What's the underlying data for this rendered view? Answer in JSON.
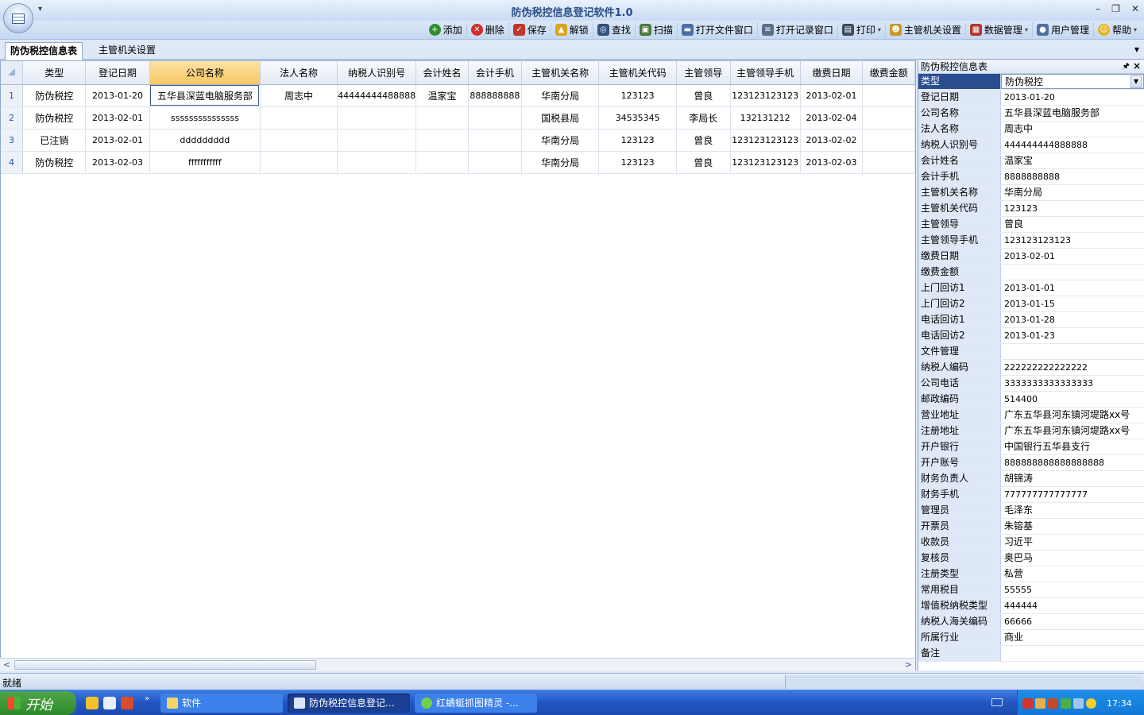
{
  "window": {
    "title": "防伪税控信息登记软件1.0"
  },
  "toolbar": {
    "buttons": [
      {
        "label": "添加",
        "icon": "add-icon",
        "color": "#2f8f2f"
      },
      {
        "label": "删除",
        "icon": "delete-icon",
        "color": "#d52b2b"
      },
      {
        "label": "保存",
        "icon": "save-icon",
        "color": "#c0362c"
      },
      {
        "label": "解锁",
        "icon": "lock-icon",
        "color": "#d9a520"
      },
      {
        "label": "查找",
        "icon": "search-icon",
        "color": "#34507c"
      },
      {
        "label": "扫描",
        "icon": "scan-icon",
        "color": "#4a7a3c"
      },
      {
        "label": "打开文件窗口",
        "icon": "folder-icon",
        "color": "#4b6ea8"
      },
      {
        "label": "打开记录窗口",
        "icon": "list-icon",
        "color": "#5c6f8a"
      },
      {
        "label": "打印",
        "icon": "print-icon",
        "color": "#3d4a5c",
        "dropdown": true
      },
      {
        "label": "主管机关设置",
        "icon": "person-settings-icon",
        "color": "#c9962a"
      },
      {
        "label": "数据管理",
        "icon": "table-icon",
        "color": "#b2352d",
        "dropdown": true
      },
      {
        "label": "用户管理",
        "icon": "user-icon",
        "color": "#4d6fa3"
      },
      {
        "label": "帮助",
        "icon": "help-smiley-icon",
        "color": "#e6b421",
        "dropdown": true
      }
    ]
  },
  "tabs": {
    "active": "防伪税控信息表",
    "inactive": "主管机关设置"
  },
  "grid": {
    "columns": [
      "类型",
      "登记日期",
      "公司名称",
      "法人名称",
      "纳税人识别号",
      "会计姓名",
      "会计手机",
      "主管机关名称",
      "主管机关代码",
      "主管领导",
      "主管领导手机",
      "缴费日期",
      "缴费金额"
    ],
    "rows": [
      {
        "n": "1",
        "cells": [
          "防伪税控",
          "2013-01-20",
          "五华县深蓝电脑服务部",
          "周志中",
          "44444444488888",
          "温家宝",
          "888888888",
          "华南分局",
          "123123",
          "曾良",
          "123123123123",
          "2013-02-01",
          ""
        ]
      },
      {
        "n": "2",
        "cells": [
          "防伪税控",
          "2013-02-01",
          "sssssssssssssss",
          "",
          "",
          "",
          "",
          "国税县局",
          "34535345",
          "李局长",
          "132131212",
          "2013-02-04",
          ""
        ]
      },
      {
        "n": "3",
        "cells": [
          "已注销",
          "2013-02-01",
          "ddddddddd",
          "",
          "",
          "",
          "",
          "华南分局",
          "123123",
          "曾良",
          "123123123123",
          "2013-02-02",
          ""
        ]
      },
      {
        "n": "4",
        "cells": [
          "防伪税控",
          "2013-02-03",
          "fffffffffff",
          "",
          "",
          "",
          "",
          "华南分局",
          "123123",
          "曾良",
          "123123123123",
          "2013-02-03",
          ""
        ]
      }
    ]
  },
  "panel": {
    "title": "防伪税控信息表",
    "pin_glyph": "𝟺",
    "close_glyph": "✕",
    "rows": [
      {
        "label": "类型",
        "value": "防伪税控"
      },
      {
        "label": "登记日期",
        "value": "2013-01-20"
      },
      {
        "label": "公司名称",
        "value": "五华县深蓝电脑服务部"
      },
      {
        "label": "法人名称",
        "value": "周志中"
      },
      {
        "label": "纳税人识别号",
        "value": "444444444888888"
      },
      {
        "label": "会计姓名",
        "value": "温家宝"
      },
      {
        "label": "会计手机",
        "value": "8888888888"
      },
      {
        "label": "主管机关名称",
        "value": "华南分局"
      },
      {
        "label": "主管机关代码",
        "value": "123123"
      },
      {
        "label": "主管领导",
        "value": "曾良"
      },
      {
        "label": "主管领导手机",
        "value": "123123123123"
      },
      {
        "label": "缴费日期",
        "value": "2013-02-01"
      },
      {
        "label": "缴费金额",
        "value": ""
      },
      {
        "label": "上门回访1",
        "value": "2013-01-01"
      },
      {
        "label": "上门回访2",
        "value": "2013-01-15"
      },
      {
        "label": "电话回访1",
        "value": "2013-01-28"
      },
      {
        "label": "电话回访2",
        "value": "2013-01-23"
      },
      {
        "label": "文件管理",
        "value": ""
      },
      {
        "label": "纳税人编码",
        "value": "222222222222222"
      },
      {
        "label": "公司电话",
        "value": "3333333333333333"
      },
      {
        "label": "邮政编码",
        "value": "514400"
      },
      {
        "label": "营业地址",
        "value": "广东五华县河东镇河堤路xx号"
      },
      {
        "label": "注册地址",
        "value": "广东五华县河东镇河堤路xx号"
      },
      {
        "label": "开户银行",
        "value": "中国银行五华县支行"
      },
      {
        "label": "开户账号",
        "value": "888888888888888888"
      },
      {
        "label": "财务负责人",
        "value": "胡锦涛"
      },
      {
        "label": "财务手机",
        "value": "777777777777777"
      },
      {
        "label": "管理员",
        "value": "毛泽东"
      },
      {
        "label": "开票员",
        "value": "朱镕基"
      },
      {
        "label": "收款员",
        "value": "习近平"
      },
      {
        "label": "复核员",
        "value": "奥巴马"
      },
      {
        "label": "注册类型",
        "value": "私营"
      },
      {
        "label": "常用税目",
        "value": "55555"
      },
      {
        "label": "增值税纳税类型",
        "value": "444444"
      },
      {
        "label": "纳税人海关编码",
        "value": "66666"
      },
      {
        "label": "所属行业",
        "value": "商业"
      },
      {
        "label": "备注",
        "value": ""
      }
    ]
  },
  "status": {
    "text": "就绪"
  },
  "taskbar": {
    "start": "开始",
    "tasks": [
      "软件",
      "防伪税控信息登记...",
      "红蜻蜓抓图精灵 -..."
    ],
    "clock": "17:34"
  }
}
